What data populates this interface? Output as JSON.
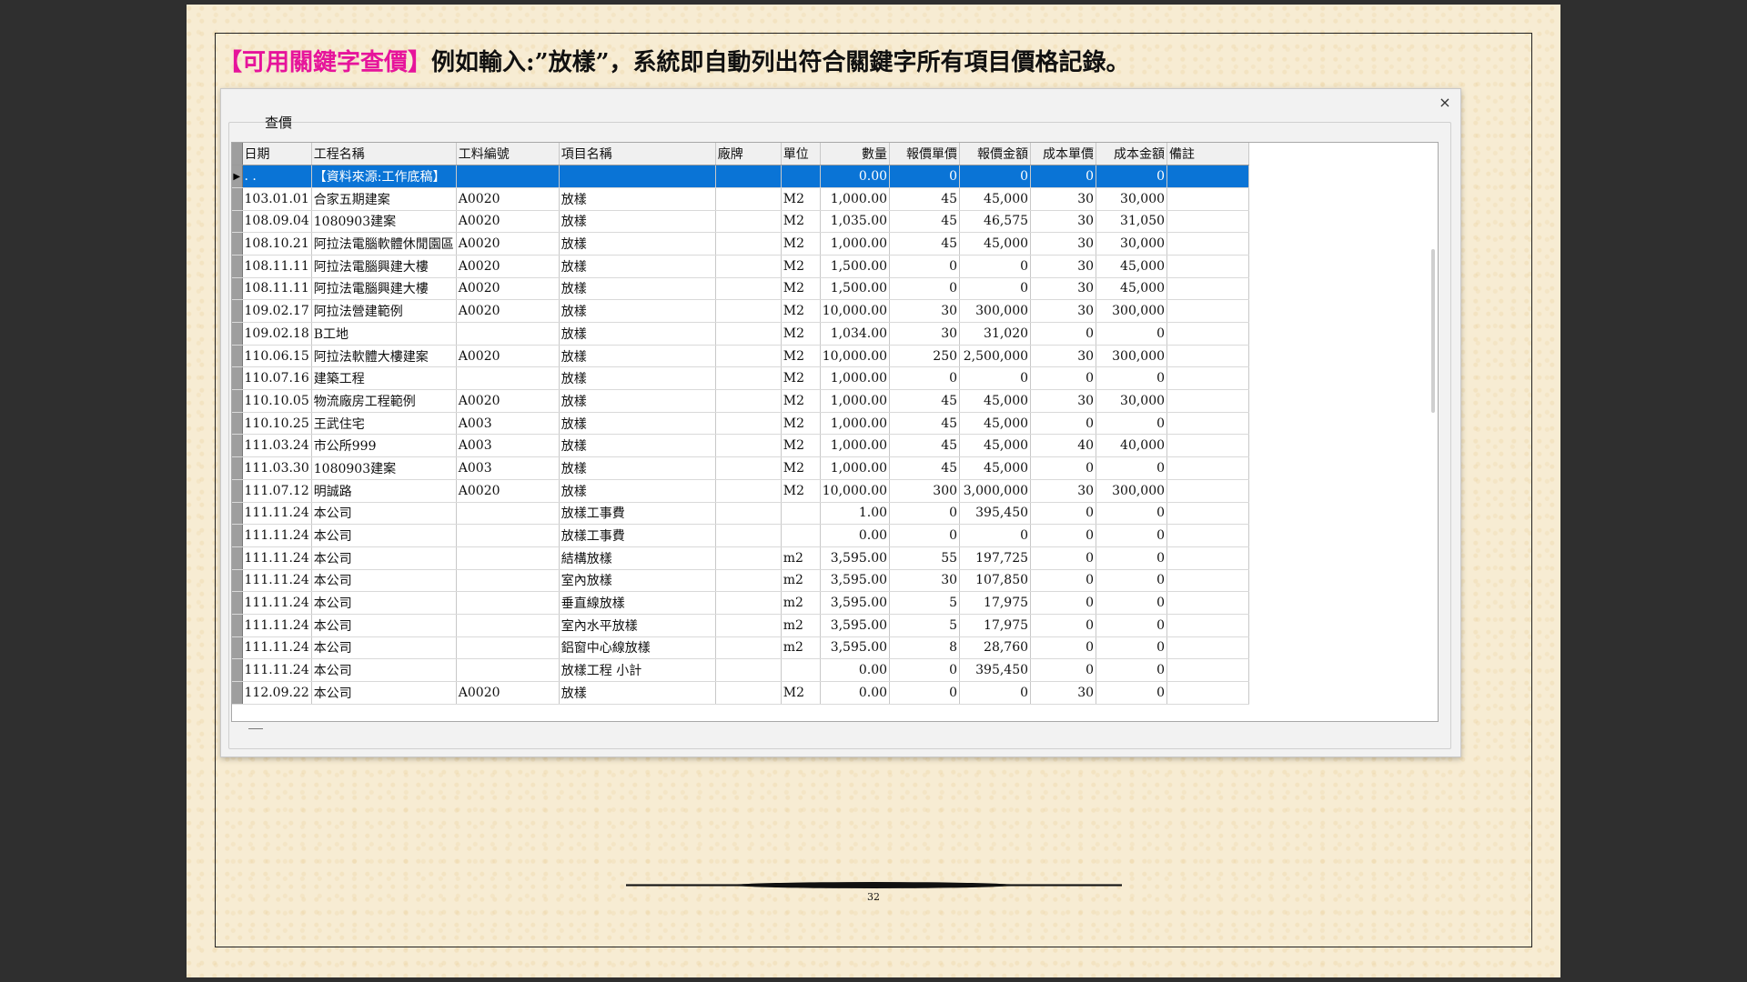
{
  "heading": {
    "highlight": "【可用關鍵字查價】",
    "text": "例如輸入:”放樣”，系統即自動列出符合關鍵字所有項目價格記錄。"
  },
  "dialog": {
    "close_label": "×",
    "group_label": "查價",
    "columns": [
      "日期",
      "工程名稱",
      "工料編號",
      "項目名稱",
      "廠牌",
      "單位",
      "數量",
      "報價單價",
      "報價金額",
      "成本單價",
      "成本金額",
      "備註"
    ],
    "selected_row": {
      "indicator": "▶",
      "date": ". .",
      "project": "【資料來源:工作底稿】",
      "code": "",
      "item": "",
      "brand": "",
      "unit": "",
      "qty": "0.00",
      "quote_price": "0",
      "quote_amount": "0",
      "cost_price": "0",
      "cost_amount": "0",
      "note": ""
    },
    "rows": [
      [
        "103.01.01",
        "合家五期建案",
        "A0020",
        "放樣",
        "",
        "M2",
        "1,000.00",
        "45",
        "45,000",
        "30",
        "30,000",
        ""
      ],
      [
        "108.09.04",
        "1080903建案",
        "A0020",
        "放樣",
        "",
        "M2",
        "1,035.00",
        "45",
        "46,575",
        "30",
        "31,050",
        ""
      ],
      [
        "108.10.21",
        "阿拉法電腦軟體休閒園區",
        "A0020",
        "放樣",
        "",
        "M2",
        "1,000.00",
        "45",
        "45,000",
        "30",
        "30,000",
        ""
      ],
      [
        "108.11.11",
        "阿拉法電腦興建大樓",
        "A0020",
        "放樣",
        "",
        "M2",
        "1,500.00",
        "0",
        "0",
        "30",
        "45,000",
        ""
      ],
      [
        "108.11.11",
        "阿拉法電腦興建大樓",
        "A0020",
        "放樣",
        "",
        "M2",
        "1,500.00",
        "0",
        "0",
        "30",
        "45,000",
        ""
      ],
      [
        "109.02.17",
        "阿拉法營建範例",
        "A0020",
        "放樣",
        "",
        "M2",
        "10,000.00",
        "30",
        "300,000",
        "30",
        "300,000",
        ""
      ],
      [
        "109.02.18",
        "B工地",
        "",
        "放樣",
        "",
        "M2",
        "1,034.00",
        "30",
        "31,020",
        "0",
        "0",
        ""
      ],
      [
        "110.06.15",
        "阿拉法軟體大樓建案",
        "A0020",
        "放樣",
        "",
        "M2",
        "10,000.00",
        "250",
        "2,500,000",
        "30",
        "300,000",
        ""
      ],
      [
        "110.07.16",
        "建築工程",
        "",
        "放樣",
        "",
        "M2",
        "1,000.00",
        "0",
        "0",
        "0",
        "0",
        ""
      ],
      [
        "110.10.05",
        "物流廠房工程範例",
        "A0020",
        "放樣",
        "",
        "M2",
        "1,000.00",
        "45",
        "45,000",
        "30",
        "30,000",
        ""
      ],
      [
        "110.10.25",
        "王武住宅",
        "A003",
        "放樣",
        "",
        "M2",
        "1,000.00",
        "45",
        "45,000",
        "0",
        "0",
        ""
      ],
      [
        "111.03.24",
        "市公所999",
        "A003",
        "放樣",
        "",
        "M2",
        "1,000.00",
        "45",
        "45,000",
        "40",
        "40,000",
        ""
      ],
      [
        "111.03.30",
        "1080903建案",
        "A003",
        "放樣",
        "",
        "M2",
        "1,000.00",
        "45",
        "45,000",
        "0",
        "0",
        ""
      ],
      [
        "111.07.12",
        "明誠路",
        "A0020",
        "放樣",
        "",
        "M2",
        "10,000.00",
        "300",
        "3,000,000",
        "30",
        "300,000",
        ""
      ],
      [
        "111.11.24",
        "本公司",
        "",
        "放樣工事費",
        "",
        "",
        "1.00",
        "0",
        "395,450",
        "0",
        "0",
        ""
      ],
      [
        "111.11.24",
        "本公司",
        "",
        "放樣工事費",
        "",
        "",
        "0.00",
        "0",
        "0",
        "0",
        "0",
        ""
      ],
      [
        "111.11.24",
        "本公司",
        "",
        "結構放樣",
        "",
        "m2",
        "3,595.00",
        "55",
        "197,725",
        "0",
        "0",
        ""
      ],
      [
        "111.11.24",
        "本公司",
        "",
        "室內放樣",
        "",
        "m2",
        "3,595.00",
        "30",
        "107,850",
        "0",
        "0",
        ""
      ],
      [
        "111.11.24",
        "本公司",
        "",
        "垂直線放樣",
        "",
        "m2",
        "3,595.00",
        "5",
        "17,975",
        "0",
        "0",
        ""
      ],
      [
        "111.11.24",
        "本公司",
        "",
        "室內水平放樣",
        "",
        "m2",
        "3,595.00",
        "5",
        "17,975",
        "0",
        "0",
        ""
      ],
      [
        "111.11.24",
        "本公司",
        "",
        "鋁窗中心線放樣",
        "",
        "m2",
        "3,595.00",
        "8",
        "28,760",
        "0",
        "0",
        ""
      ],
      [
        "111.11.24",
        "本公司",
        "",
        "放樣工程 小計",
        "",
        "",
        "0.00",
        "0",
        "395,450",
        "0",
        "0",
        ""
      ],
      [
        "112.09.22",
        "本公司",
        "A0020",
        "放樣",
        "",
        "M2",
        "0.00",
        "0",
        "0",
        "30",
        "0",
        ""
      ]
    ]
  },
  "footer": {
    "page_number": "32"
  }
}
